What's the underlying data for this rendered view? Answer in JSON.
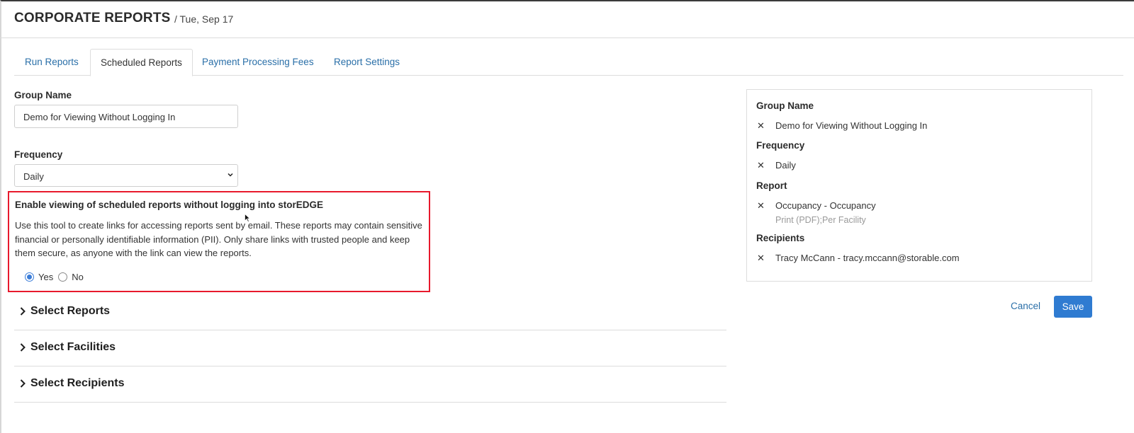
{
  "header": {
    "title": "CORPORATE REPORTS",
    "subtitle": "/ Tue, Sep 17"
  },
  "tabs": [
    {
      "label": "Run Reports",
      "active": false
    },
    {
      "label": "Scheduled Reports",
      "active": true
    },
    {
      "label": "Payment Processing Fees",
      "active": false
    },
    {
      "label": "Report Settings",
      "active": false
    }
  ],
  "form": {
    "group_name_label": "Group Name",
    "group_name_value": "Demo for Viewing Without Logging In",
    "frequency_label": "Frequency",
    "frequency_value": "Daily"
  },
  "notice": {
    "title": "Enable viewing of scheduled reports without logging into storEDGE",
    "text": "Use this tool to create links for accessing reports sent by email. These reports may contain sensitive financial or personally identifiable information (PII). Only share links with trusted people and keep them secure, as anyone with the link can view the reports.",
    "yes_label": "Yes",
    "no_label": "No",
    "selected": "Yes",
    "border_color": "#e8192c"
  },
  "sections": [
    {
      "title": "Select Reports"
    },
    {
      "title": "Select Facilities"
    },
    {
      "title": "Select Recipients"
    }
  ],
  "summary": {
    "group_name_label": "Group Name",
    "group_name_value": "Demo for Viewing Without Logging In",
    "frequency_label": "Frequency",
    "frequency_value": "Daily",
    "report_label": "Report",
    "report_value": "Occupancy - Occupancy",
    "report_detail": "Print (PDF);Per Facility",
    "recipients_label": "Recipients",
    "recipients_value": "Tracy McCann - tracy.mccann@storable.com",
    "remove_glyph": "✕"
  },
  "actions": {
    "cancel_label": "Cancel",
    "save_label": "Save",
    "save_color": "#2f7bd1"
  },
  "icons": {
    "chevron_right": "chevron-right-icon",
    "chevron_down": "chevron-down-icon",
    "remove": "close-icon",
    "cursor": "mouse-pointer-icon"
  }
}
